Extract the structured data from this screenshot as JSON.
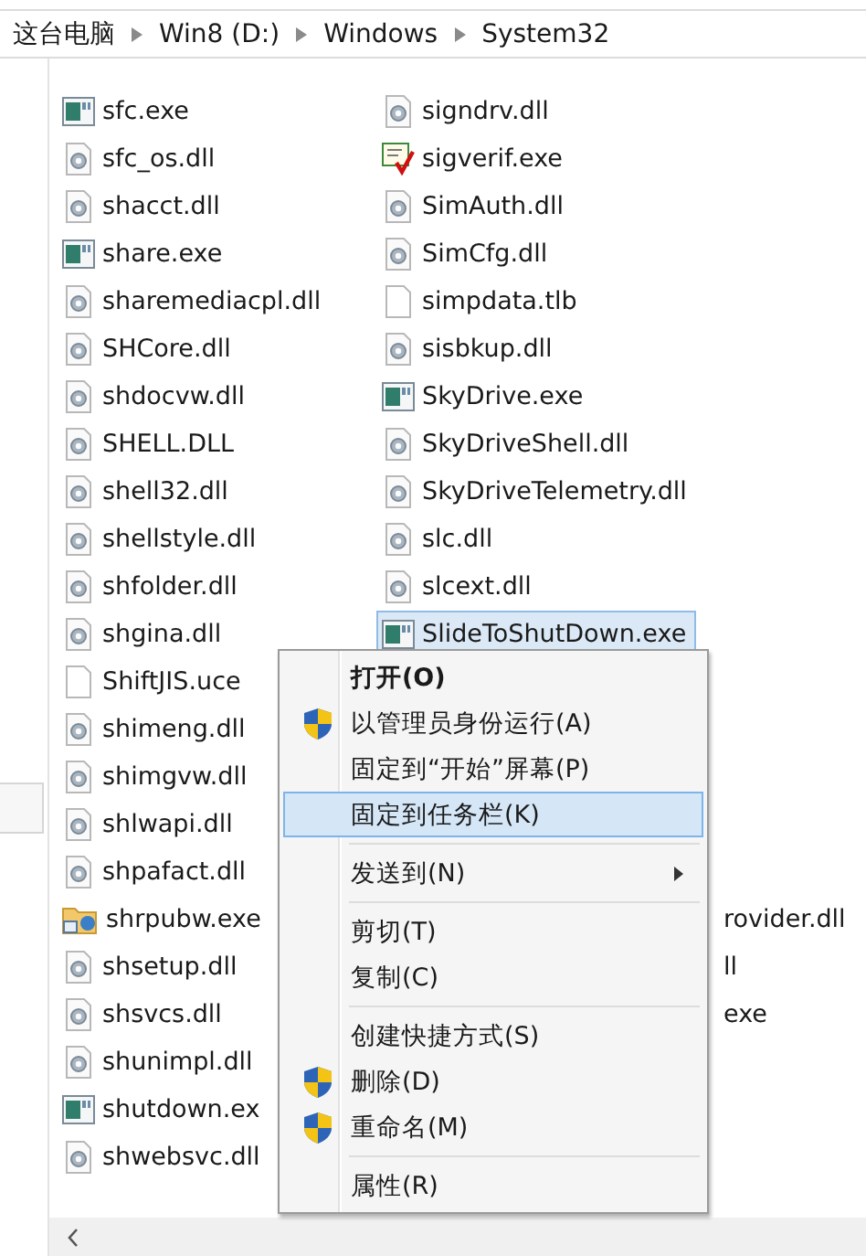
{
  "breadcrumb": [
    "这台电脑",
    "Win8 (D:)",
    "Windows",
    "System32"
  ],
  "files_column_1": [
    {
      "name": "sfc.exe",
      "kind": "exe",
      "selected": false
    },
    {
      "name": "sfc_os.dll",
      "kind": "dll",
      "selected": false
    },
    {
      "name": "shacct.dll",
      "kind": "dll",
      "selected": false
    },
    {
      "name": "share.exe",
      "kind": "exe",
      "selected": false
    },
    {
      "name": "sharemediacpl.dll",
      "kind": "dll",
      "selected": false
    },
    {
      "name": "SHCore.dll",
      "kind": "dll",
      "selected": false
    },
    {
      "name": "shdocvw.dll",
      "kind": "dll",
      "selected": false
    },
    {
      "name": "SHELL.DLL",
      "kind": "dll",
      "selected": false
    },
    {
      "name": "shell32.dll",
      "kind": "dll",
      "selected": false
    },
    {
      "name": "shellstyle.dll",
      "kind": "dll",
      "selected": false
    },
    {
      "name": "shfolder.dll",
      "kind": "dll",
      "selected": false
    },
    {
      "name": "shgina.dll",
      "kind": "dll",
      "selected": false
    },
    {
      "name": "ShiftJIS.uce",
      "kind": "blank",
      "selected": false
    },
    {
      "name": "shimeng.dll",
      "kind": "dll",
      "selected": false
    },
    {
      "name": "shimgvw.dll",
      "kind": "dll",
      "selected": false
    },
    {
      "name": "shlwapi.dll",
      "kind": "dll",
      "selected": false
    },
    {
      "name": "shpafact.dll",
      "kind": "dll",
      "selected": false
    },
    {
      "name": "shrpubw.exe",
      "kind": "share",
      "selected": false
    },
    {
      "name": "shsetup.dll",
      "kind": "dll",
      "selected": false
    },
    {
      "name": "shsvcs.dll",
      "kind": "dll",
      "selected": false
    },
    {
      "name": "shunimpl.dll",
      "kind": "dll",
      "selected": false
    },
    {
      "name": "shutdown.ex",
      "kind": "exe",
      "selected": false
    },
    {
      "name": "shwebsvc.dll",
      "kind": "dll",
      "selected": false
    }
  ],
  "files_column_2": [
    {
      "name": "signdrv.dll",
      "kind": "dll",
      "selected": false
    },
    {
      "name": "sigverif.exe",
      "kind": "cert",
      "selected": false
    },
    {
      "name": "SimAuth.dll",
      "kind": "dll",
      "selected": false
    },
    {
      "name": "SimCfg.dll",
      "kind": "dll",
      "selected": false
    },
    {
      "name": "simpdata.tlb",
      "kind": "blank",
      "selected": false
    },
    {
      "name": "sisbkup.dll",
      "kind": "dll",
      "selected": false
    },
    {
      "name": "SkyDrive.exe",
      "kind": "exe",
      "selected": false
    },
    {
      "name": "SkyDriveShell.dll",
      "kind": "dll",
      "selected": false
    },
    {
      "name": "SkyDriveTelemetry.dll",
      "kind": "dll",
      "selected": false
    },
    {
      "name": "slc.dll",
      "kind": "dll",
      "selected": false
    },
    {
      "name": "slcext.dll",
      "kind": "dll",
      "selected": false
    },
    {
      "name": "SlideToShutDown.exe",
      "kind": "exe",
      "selected": true
    }
  ],
  "covered_column_2_tails": [
    "rovider.dll",
    "ll",
    "exe"
  ],
  "context_menu": [
    {
      "kind": "item",
      "label": "打开(O)",
      "bold": true,
      "shield": false,
      "selected": false,
      "submenu": false
    },
    {
      "kind": "item",
      "label": "以管理员身份运行(A)",
      "bold": false,
      "shield": true,
      "selected": false,
      "submenu": false
    },
    {
      "kind": "item",
      "label": "固定到“开始”屏幕(P)",
      "bold": false,
      "shield": false,
      "selected": false,
      "submenu": false
    },
    {
      "kind": "item",
      "label": "固定到任务栏(K)",
      "bold": false,
      "shield": false,
      "selected": true,
      "submenu": false
    },
    {
      "kind": "separator"
    },
    {
      "kind": "item",
      "label": "发送到(N)",
      "bold": false,
      "shield": false,
      "selected": false,
      "submenu": true
    },
    {
      "kind": "separator"
    },
    {
      "kind": "item",
      "label": "剪切(T)",
      "bold": false,
      "shield": false,
      "selected": false,
      "submenu": false
    },
    {
      "kind": "item",
      "label": "复制(C)",
      "bold": false,
      "shield": false,
      "selected": false,
      "submenu": false
    },
    {
      "kind": "separator"
    },
    {
      "kind": "item",
      "label": "创建快捷方式(S)",
      "bold": false,
      "shield": false,
      "selected": false,
      "submenu": false
    },
    {
      "kind": "item",
      "label": "删除(D)",
      "bold": false,
      "shield": true,
      "selected": false,
      "submenu": false
    },
    {
      "kind": "item",
      "label": "重命名(M)",
      "bold": false,
      "shield": true,
      "selected": false,
      "submenu": false
    },
    {
      "kind": "separator"
    },
    {
      "kind": "item",
      "label": "属性(R)",
      "bold": false,
      "shield": false,
      "selected": false,
      "submenu": false
    }
  ]
}
